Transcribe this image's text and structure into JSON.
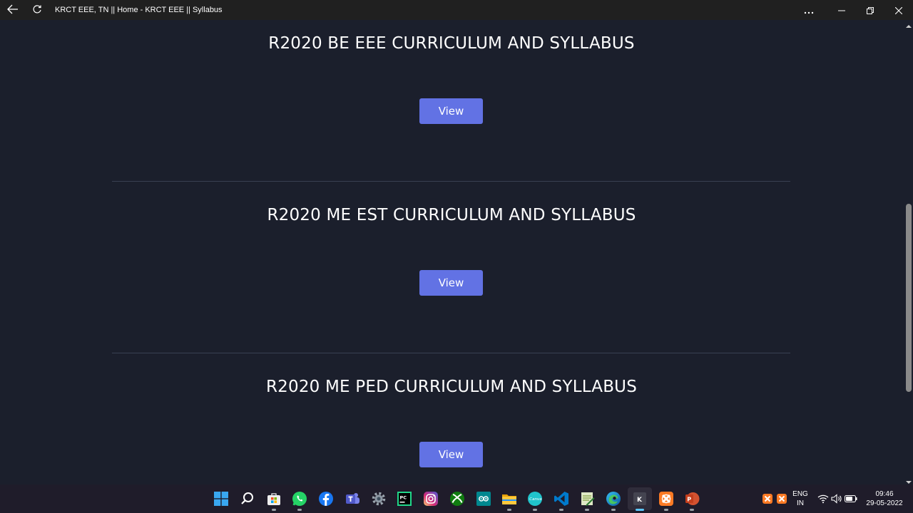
{
  "window": {
    "title": "KRCT EEE, TN || Home - KRCT EEE || Syllabus"
  },
  "sections": [
    {
      "title": "R2020 BE EEE CURRICULUM AND SYLLABUS",
      "button": "View"
    },
    {
      "title": "R2020 ME EST CURRICULUM AND SYLLABUS",
      "button": "View"
    },
    {
      "title": "R2020 ME PED CURRICULUM AND SYLLABUS",
      "button": "View"
    }
  ],
  "taskbar": {
    "apps": [
      "start-icon",
      "search-icon",
      "store-icon",
      "whatsapp-icon",
      "facebook-icon",
      "teams-icon",
      "settings-icon",
      "pycharm-icon",
      "instagram-icon",
      "xbox-icon",
      "arduino-icon",
      "file-explorer-icon",
      "canva-icon",
      "vscode-icon",
      "notepad-icon",
      "edge-icon",
      "krct-app-icon",
      "xampp-icon",
      "powerpoint-icon"
    ],
    "language": "ENG",
    "region": "IN",
    "time": "09:46",
    "date": "29-05-2022"
  },
  "colors": {
    "background": "#1b1f2c",
    "button": "#6272e4",
    "titlebar": "#202020",
    "taskbar": "#1f1c2a"
  }
}
